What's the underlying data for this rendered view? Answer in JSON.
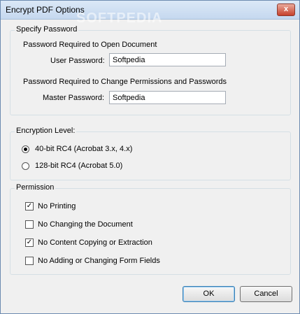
{
  "window": {
    "title": "Encrypt PDF Options",
    "close_glyph": "x",
    "watermark": "SOFTPEDIA"
  },
  "specify_password": {
    "legend": "Specify Password",
    "open_heading": "Password Required to Open Document",
    "user_label": "User Password:",
    "user_value": "Softpedia",
    "change_heading": "Password Required to Change Permissions and Passwords",
    "master_label": "Master Password:",
    "master_value": "Softpedia"
  },
  "encryption": {
    "legend": "Encryption Level:",
    "options": [
      {
        "label": "40-bit RC4 (Acrobat 3.x, 4.x)",
        "checked": true
      },
      {
        "label": "128-bit RC4 (Acrobat 5.0)",
        "checked": false
      }
    ]
  },
  "permission": {
    "legend": "Permission",
    "options": [
      {
        "label": "No Printing",
        "checked": true,
        "mark": "✓"
      },
      {
        "label": "No Changing the Document",
        "checked": false,
        "mark": ""
      },
      {
        "label": "No Content Copying or Extraction",
        "checked": true,
        "mark": "✓"
      },
      {
        "label": "No Adding or Changing Form Fields",
        "checked": false,
        "mark": ""
      }
    ]
  },
  "buttons": {
    "ok": "OK",
    "cancel": "Cancel"
  }
}
